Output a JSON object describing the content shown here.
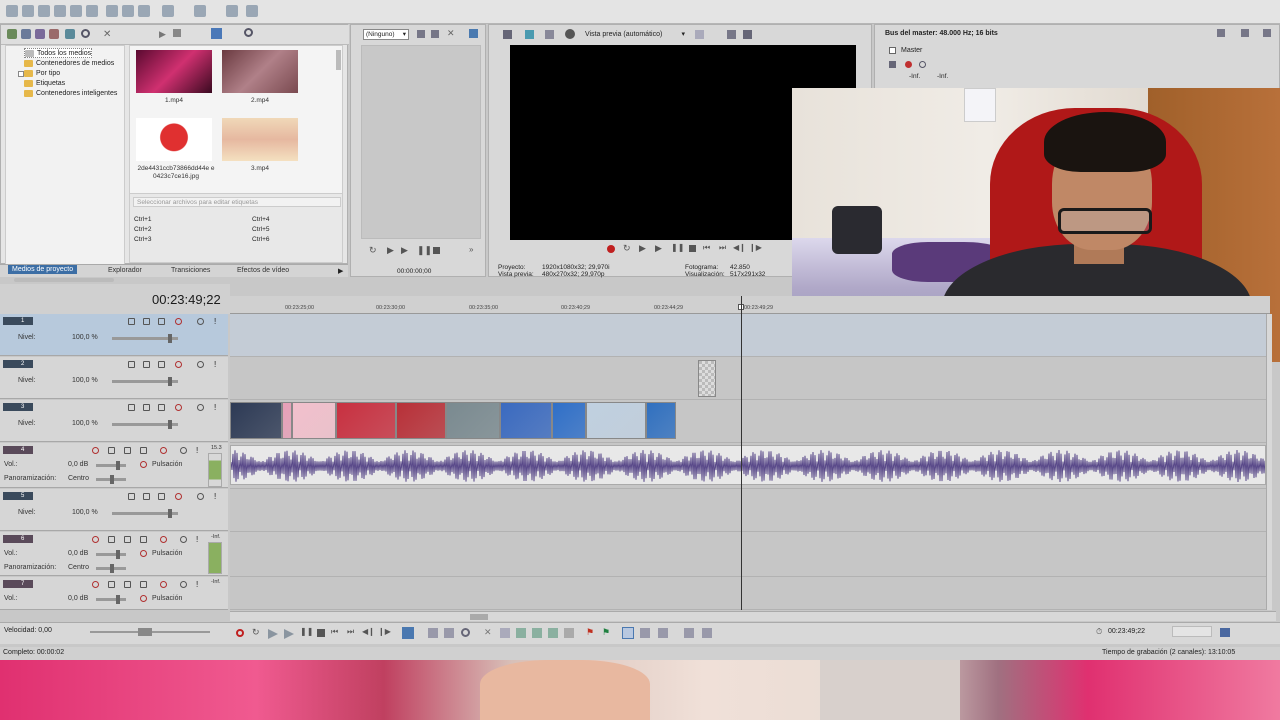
{
  "menu_bar": {
    "toolbar_icons": [
      "new-icon",
      "open-icon",
      "save-icon",
      "save-as-icon",
      "render-icon",
      "properties-icon",
      "cut-icon",
      "copy-icon",
      "paste-icon",
      "undo-icon",
      "redo-icon",
      "help-icon",
      "context-help-icon"
    ]
  },
  "media_panel": {
    "tree_items": [
      "Todos los medios",
      "Contenedores de medios",
      "Por tipo",
      "Etiquetas",
      "Contenedores inteligentes"
    ],
    "thumbnails": [
      {
        "caption": "1.mp4",
        "color": "#8a1540"
      },
      {
        "caption": "2.mp4",
        "color": "#8b5a5f"
      },
      {
        "caption": "2de4431ccb73866dd44e e0423c7ce16.jpg",
        "color": "#cc1f1f"
      },
      {
        "caption": "3.mp4",
        "color": "#e9c9a8"
      }
    ],
    "tag_placeholder": "Seleccionar archivos para editar etiquetas",
    "shortcuts": [
      "Ctrl+1",
      "Ctrl+4",
      "Ctrl+2",
      "Ctrl+5",
      "Ctrl+3",
      "Ctrl+6"
    ]
  },
  "tabs": [
    "Medios de proyecto",
    "Explorador",
    "Transiciones",
    "Efectos de vídeo"
  ],
  "trimmer": {
    "dropdown": "(Ninguno)",
    "time": "00:00:00;00"
  },
  "preview": {
    "mode": "Vista previa (automático)",
    "project_label": "Proyecto:",
    "project_value": "1920x1080x32; 29,970i",
    "preview_label": "Vista previa:",
    "preview_value": "480x270x32; 29,970p",
    "frame_label": "Fotograma:",
    "frame_value": "42.850",
    "display_label": "Visualización:",
    "display_value": "517x291x32"
  },
  "master_bus": {
    "title": "Bus del master: 48.000 Hz; 16 bits",
    "master_label": "Master",
    "inf1": "-Inf.",
    "inf2": "-Inf."
  },
  "timeline": {
    "timecode": "00:23:49;22",
    "ruler_labels": [
      "00:23:25;00",
      "00:23:30;00",
      "00:23:35;00",
      "00:23:40;29",
      "00:23:44;29",
      "00:23:49;29"
    ],
    "tracks": [
      {
        "num": "1",
        "type": "video",
        "label": "Nivel:",
        "value": "100,0 %"
      },
      {
        "num": "2",
        "type": "video",
        "label": "Nivel:",
        "value": "100,0 %"
      },
      {
        "num": "3",
        "type": "video",
        "label": "Nivel:",
        "value": "100,0 %"
      },
      {
        "num": "4",
        "type": "audio",
        "vol_label": "Vol.:",
        "vol_value": "0,0 dB",
        "pan_label": "Panoramización:",
        "pan_value": "Centro",
        "mode": "Pulsación",
        "meter": "15.3"
      },
      {
        "num": "5",
        "type": "video",
        "label": "Nivel:",
        "value": "100,0 %"
      },
      {
        "num": "6",
        "type": "audio",
        "vol_label": "Vol.:",
        "vol_value": "0,0 dB",
        "pan_label": "Panoramización:",
        "pan_value": "Centro",
        "mode": "Pulsación",
        "meter": "-Inf."
      },
      {
        "num": "7",
        "type": "audio",
        "vol_label": "Vol.:",
        "vol_value": "0,0 dB",
        "mode": "Pulsación",
        "meter": "-Inf."
      }
    ],
    "clip_colors": [
      "#2d3a55",
      "#e8a0b8",
      "#f2c0cc",
      "#c83040",
      "#b83038",
      "#7a8a90",
      "#3a6ac0",
      "#2f6fc8",
      "#c0d0e0",
      "#3070c0"
    ]
  },
  "transport": {
    "speed_label": "Velocidad: 0,00",
    "time_right": "00:23:49;22"
  },
  "status": {
    "left": "Completo: 00:00:02",
    "right": "Tiempo de grabación (2 canales): 13:10:05"
  }
}
